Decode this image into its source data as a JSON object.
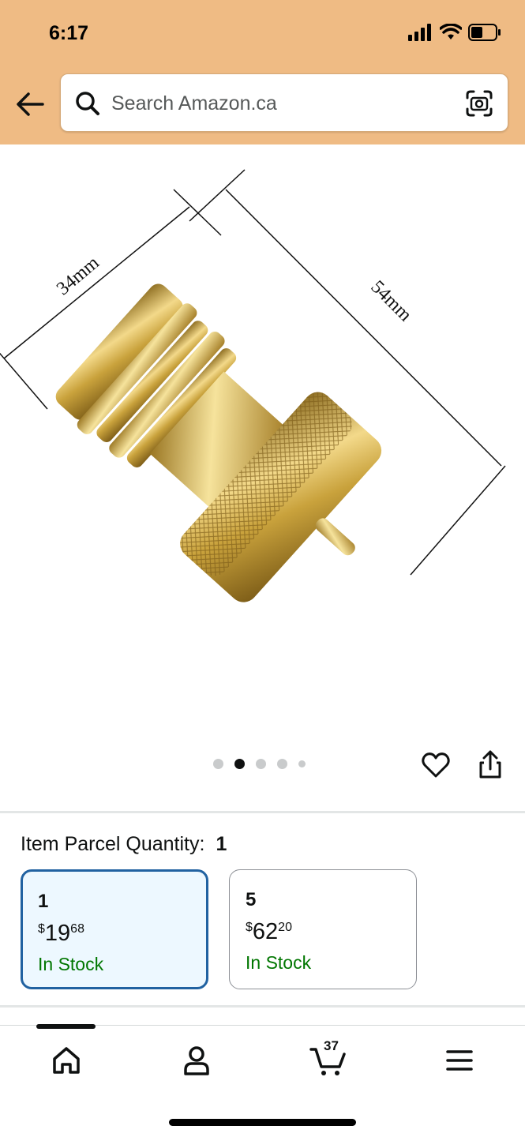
{
  "status_bar": {
    "time": "6:17"
  },
  "search": {
    "placeholder": "Search Amazon.ca"
  },
  "product_image": {
    "dimension_width": "34mm",
    "dimension_length": "54mm"
  },
  "carousel": {
    "total_dots": 5,
    "active_index": 1
  },
  "quantity": {
    "label": "Item Parcel Quantity:",
    "selected_value": "1",
    "options": [
      {
        "qty": "1",
        "currency": "$",
        "price_whole": "19",
        "price_fraction": "68",
        "stock": "In Stock",
        "selected": true
      },
      {
        "qty": "5",
        "currency": "$",
        "price_whole": "62",
        "price_fraction": "20",
        "stock": "In Stock",
        "selected": false
      }
    ]
  },
  "nav": {
    "cart_count": "37"
  },
  "colors": {
    "header_bg": "#efbb84",
    "selected_border": "#2162a1",
    "stock_green": "#007600"
  }
}
